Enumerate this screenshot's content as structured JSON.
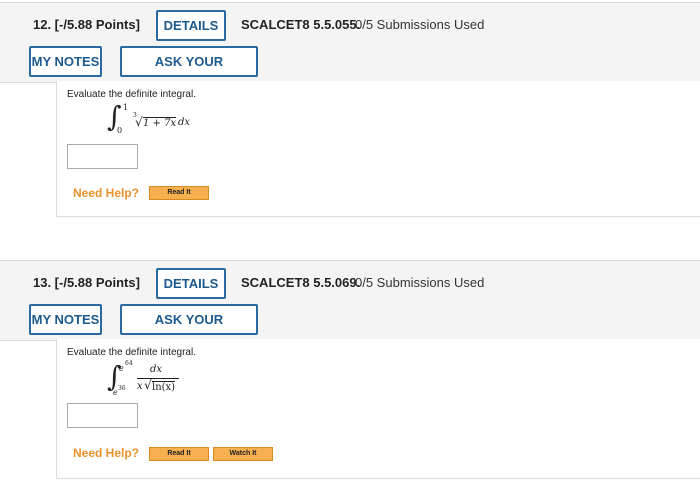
{
  "questions": [
    {
      "number_points": "12. [-/5.88 Points]",
      "details_label": "DETAILS",
      "code": "SCALCET8 5.5.055.",
      "submissions": "0/5 Submissions Used",
      "my_notes_label": "MY NOTES",
      "ask_teacher_label": "ASK YOUR TEACHER",
      "prompt": "Evaluate the definite integral.",
      "integral": {
        "upper": "1",
        "lower": "0",
        "root_index": "3",
        "radicand": "1 + 7x",
        "differential": "dx"
      },
      "need_help_label": "Need Help?",
      "help_buttons": [
        "Read It"
      ]
    },
    {
      "number_points": "13. [-/5.88 Points]",
      "details_label": "DETAILS",
      "code": "SCALCET8 5.5.069.",
      "submissions": "0/5 Submissions Used",
      "my_notes_label": "MY NOTES",
      "ask_teacher_label": "ASK YOUR TEACHER",
      "prompt": "Evaluate the definite integral.",
      "integral": {
        "upper_base": "e",
        "upper_exp": "64",
        "lower_base": "e",
        "lower_exp": "36",
        "numerator": "dx",
        "denom_prefix": "x",
        "denom_radicand": "ln(x)"
      },
      "need_help_label": "Need Help?",
      "help_buttons": [
        "Read It",
        "Watch It"
      ]
    }
  ],
  "colors": {
    "accent": "#2a6aa0",
    "help": "#e8922c",
    "help_button": "#f7b050",
    "header_bg": "#f4f4f4"
  }
}
